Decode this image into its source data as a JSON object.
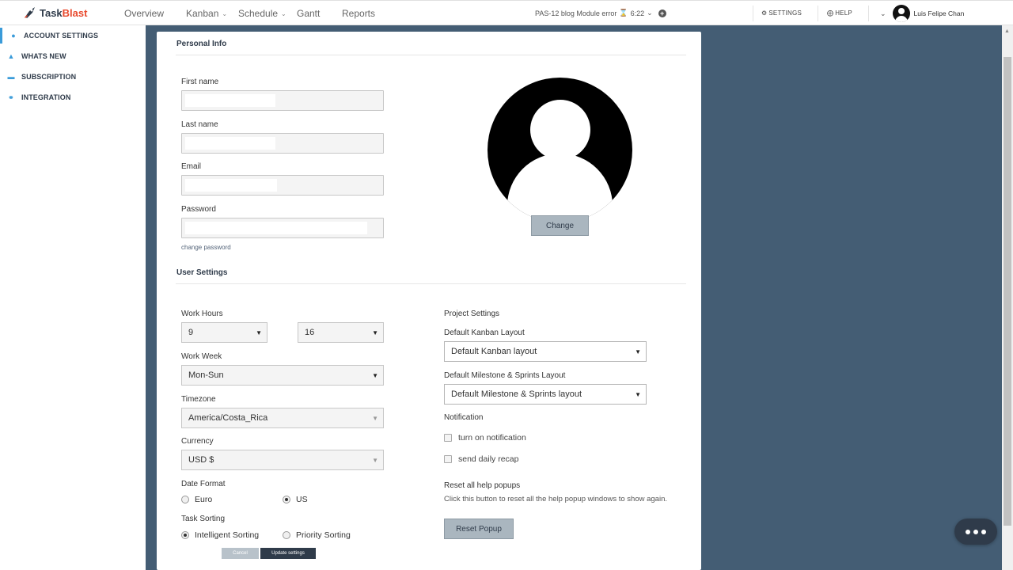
{
  "app": {
    "logo_part1": "Task",
    "logo_part2": "Blast"
  },
  "nav": {
    "overview": "Overview",
    "kanban": "Kanban",
    "schedule": "Schedule",
    "gantt": "Gantt",
    "reports": "Reports"
  },
  "task_timer": {
    "task": "PAS-12 blog Module error",
    "time": "6:22"
  },
  "top_links": {
    "settings": "SETTINGS",
    "help": "HELP"
  },
  "user": {
    "name": "Luis Felipe Chan"
  },
  "sidebar": {
    "items": [
      {
        "label": "ACCOUNT SETTINGS",
        "icon": "user-icon"
      },
      {
        "label": "WHATS NEW",
        "icon": "bell-icon"
      },
      {
        "label": "SUBSCRIPTION",
        "icon": "card-icon"
      },
      {
        "label": "INTEGRATION",
        "icon": "integration-icon"
      }
    ]
  },
  "personal_info": {
    "title": "Personal Info",
    "first_name_label": "First name",
    "last_name_label": "Last name",
    "email_label": "Email",
    "password_label": "Password",
    "change_password": "change password",
    "change_button": "Change"
  },
  "user_settings": {
    "title": "User Settings",
    "work_hours_label": "Work Hours",
    "work_hours_start": "9",
    "work_hours_end": "16",
    "work_week_label": "Work Week",
    "work_week": "Mon-Sun",
    "timezone_label": "Timezone",
    "timezone": "America/Costa_Rica",
    "currency_label": "Currency",
    "currency": "USD $",
    "date_format_label": "Date Format",
    "date_format_euro": "Euro",
    "date_format_us": "US",
    "date_format_selected": "US",
    "task_sorting_label": "Task Sorting",
    "sorting_intelligent": "Intelligent Sorting",
    "sorting_priority": "Priority Sorting",
    "sorting_selected": "Intelligent Sorting",
    "cancel_button": "Cancel",
    "update_button": "Update settings"
  },
  "project_settings": {
    "title": "Project Settings",
    "kanban_layout_label": "Default Kanban Layout",
    "kanban_layout": "Default Kanban layout",
    "milestone_layout_label": "Default Milestone & Sprints Layout",
    "milestone_layout": "Default Milestone & Sprints layout",
    "notification_label": "Notification",
    "turn_on_notification": "turn on notification",
    "send_daily_recap": "send daily recap",
    "reset_title": "Reset all help popups",
    "reset_desc": "Click this button to reset all the help popup windows to show again.",
    "reset_button": "Reset Popup"
  },
  "colors": {
    "accent": "#3a9bd9",
    "main_bg": "#445d74",
    "dark": "#2f3b4a"
  }
}
